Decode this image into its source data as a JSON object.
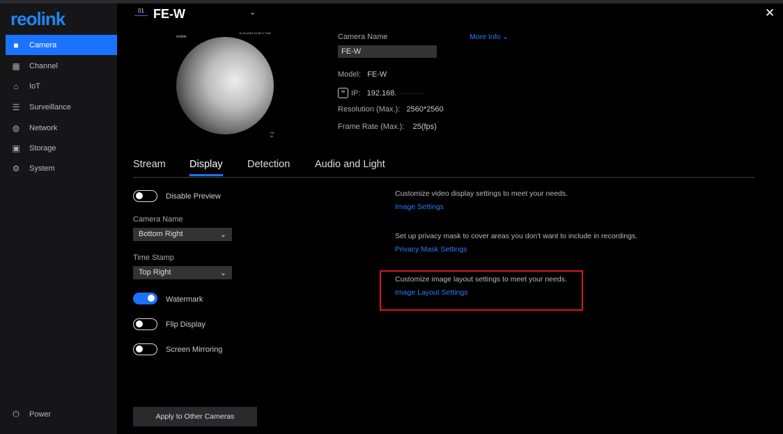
{
  "sidebar": {
    "logo": "reolink",
    "items": [
      {
        "label": "Camera",
        "icon": "camera-icon",
        "active": true
      },
      {
        "label": "Channel",
        "icon": "grid-icon"
      },
      {
        "label": "IoT",
        "icon": "home-icon"
      },
      {
        "label": "Surveillance",
        "icon": "list-icon"
      },
      {
        "label": "Network",
        "icon": "globe-icon"
      },
      {
        "label": "Storage",
        "icon": "storage-icon"
      },
      {
        "label": "System",
        "icon": "gear-icon"
      }
    ],
    "power": "Power"
  },
  "header": {
    "channel_num": "01",
    "camera": "FE-W",
    "close": "✕"
  },
  "preview": {
    "watermark": "reolink",
    "timestamp": "11-04-2023 15:49:17 TUE",
    "name_overlay": "FE-W"
  },
  "info": {
    "camera_name_label": "Camera Name",
    "camera_name": "FE-W",
    "more_info": "More Info",
    "model_label": "Model:",
    "model": "FE-W",
    "ip_label": "IP:",
    "ip": "192.168.",
    "resolution_label": "Resolution (Max.):",
    "resolution": "2560*2560",
    "framerate_label": "Frame Rate (Max.):",
    "framerate": "25(fps)"
  },
  "tabs": [
    "Stream",
    "Display",
    "Detection",
    "Audio and Light"
  ],
  "active_tab": "Display",
  "settings": {
    "disable_preview": "Disable Preview",
    "disable_preview_on": false,
    "camera_name_label": "Camera Name",
    "camera_name_pos": "Bottom Right",
    "time_stamp_label": "Time Stamp",
    "time_stamp_pos": "Top Right",
    "watermark": "Watermark",
    "watermark_on": true,
    "flip": "Flip Display",
    "flip_on": false,
    "mirror": "Screen Mirroring",
    "mirror_on": false,
    "apply": "Apply to Other Cameras"
  },
  "links": [
    {
      "desc": "Customize video display settings to meet your needs.",
      "link": "Image Settings"
    },
    {
      "desc": "Set up privacy mask to cover areas you don't want to include in recordings.",
      "link": "Privacy Mask Settings"
    },
    {
      "desc": "Customize image layout settings to meet your needs.",
      "link": "Image Layout Settings"
    }
  ],
  "colors": {
    "accent": "#1a73ff",
    "highlight_box": "#e0141e"
  }
}
